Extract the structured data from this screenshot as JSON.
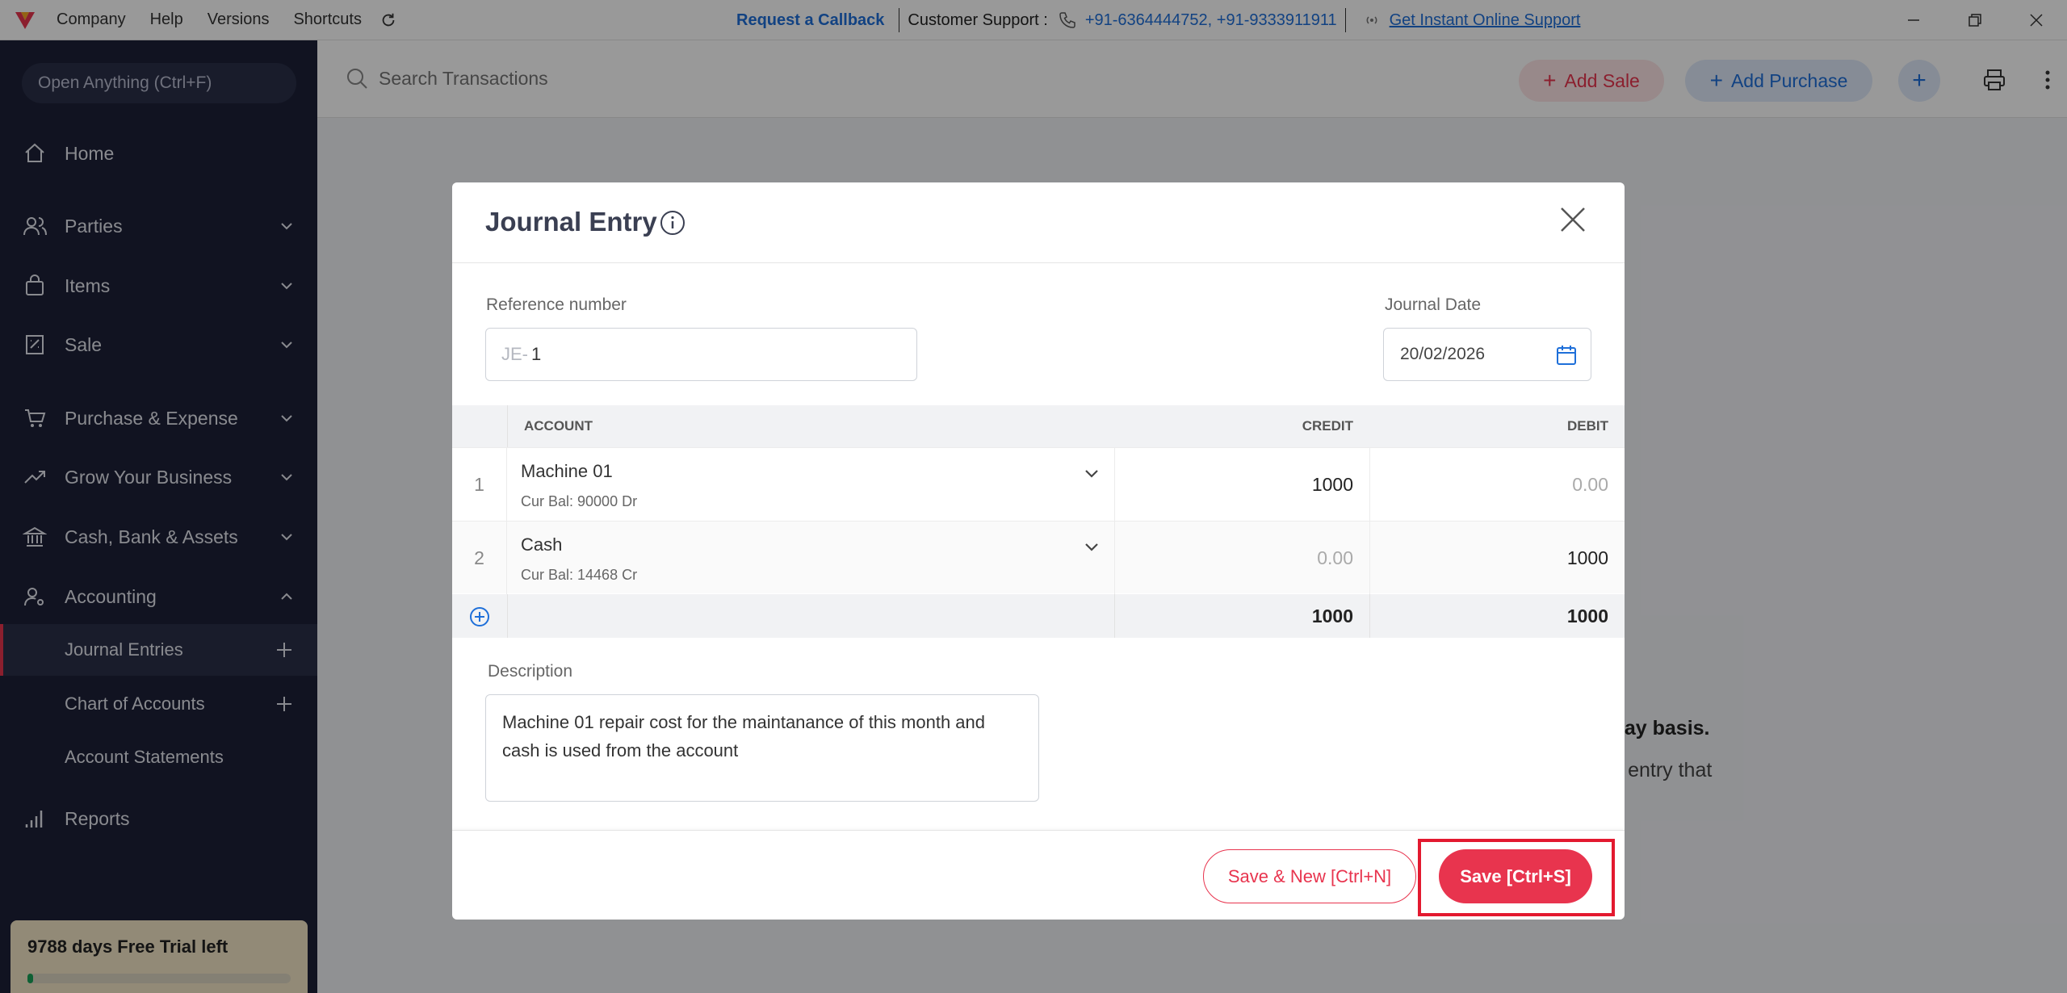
{
  "titlebar": {
    "menu": [
      "Company",
      "Help",
      "Versions",
      "Shortcuts"
    ],
    "callback": "Request a Callback",
    "support_label": "Customer Support :",
    "phones": "+91-6364444752, +91-9333911911",
    "online_support": "Get Instant Online Support"
  },
  "sidebar": {
    "open_anything": "Open Anything (Ctrl+F)",
    "items": [
      {
        "label": "Home"
      },
      {
        "label": "Parties"
      },
      {
        "label": "Items"
      },
      {
        "label": "Sale"
      },
      {
        "label": "Purchase & Expense"
      },
      {
        "label": "Grow Your Business"
      },
      {
        "label": "Cash, Bank & Assets"
      },
      {
        "label": "Accounting"
      },
      {
        "label": "Reports"
      }
    ],
    "sub_items": [
      {
        "label": "Journal Entries"
      },
      {
        "label": "Chart of Accounts"
      },
      {
        "label": "Account Statements"
      }
    ],
    "trial": {
      "text": "9788 days Free Trial left",
      "progress": 0.01
    }
  },
  "topbar": {
    "search_placeholder": "Search Transactions",
    "add_sale": "Add Sale",
    "add_purchase": "Add Purchase",
    "plus": "+"
  },
  "background": {
    "text1": "o-day basis.",
    "text2": "her entry that"
  },
  "modal": {
    "title": "Journal Entry",
    "ref_label": "Reference number",
    "ref_prefix": "JE-",
    "ref_value": "1",
    "date_label": "Journal Date",
    "date_value": "20/02/2026",
    "columns": {
      "account": "ACCOUNT",
      "credit": "CREDIT",
      "debit": "DEBIT"
    },
    "rows": [
      {
        "num": "1",
        "account": "Machine 01",
        "balance": "Cur Bal: 90000 Dr",
        "credit": "1000",
        "debit": "0.00"
      },
      {
        "num": "2",
        "account": "Cash",
        "balance": "Cur Bal: 14468 Cr",
        "credit": "0.00",
        "debit": "1000"
      }
    ],
    "totals": {
      "credit": "1000",
      "debit": "1000"
    },
    "desc_label": "Description",
    "description": "Machine 01 repair cost for the maintanance of this month and cash is used from the account",
    "save_new": "Save & New [Ctrl+N]",
    "save": "Save [Ctrl+S]"
  },
  "colors": {
    "accent": "#e8344e",
    "primary": "#1e6fd9",
    "sidebar": "#1d2137"
  }
}
